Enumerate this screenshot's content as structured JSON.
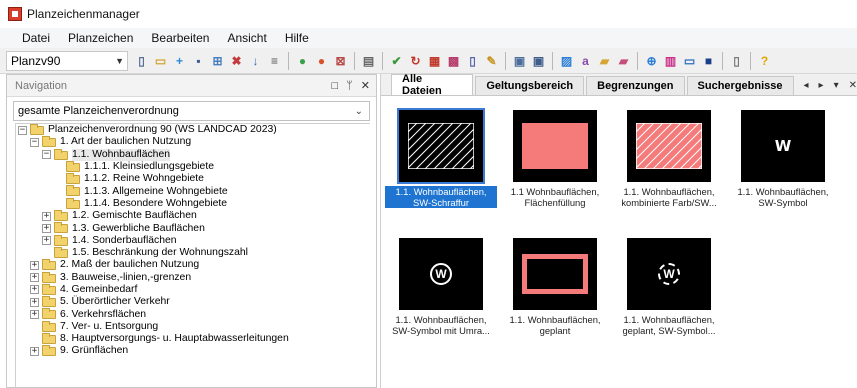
{
  "window": {
    "title": "Planzeichenmanager"
  },
  "menu": [
    "Datei",
    "Planzeichen",
    "Bearbeiten",
    "Ansicht",
    "Hilfe"
  ],
  "toolbar": {
    "combo_value": "Planzv90",
    "buttons": [
      {
        "name": "new-document-icon",
        "glyph": "▯",
        "color": "#5a6f9a"
      },
      {
        "name": "open-folder-icon",
        "glyph": "▭",
        "color": "#d4a536"
      },
      {
        "name": "add-icon",
        "glyph": "+",
        "color": "#2d8ad6"
      },
      {
        "name": "save-icon",
        "glyph": "▪",
        "color": "#3c5a9a"
      },
      {
        "name": "hierarchy-icon",
        "glyph": "⊞",
        "color": "#4a7fbf"
      },
      {
        "name": "delete-icon",
        "glyph": "✖",
        "color": "#c33b3b"
      },
      {
        "name": "sort-icon",
        "glyph": "↓",
        "color": "#3e6ab3"
      },
      {
        "name": "list-icon",
        "glyph": "≡",
        "color": "#555555"
      },
      {
        "name": "green-circle-icon",
        "glyph": "●",
        "color": "#3aa14a"
      },
      {
        "name": "red-circle-icon",
        "glyph": "●",
        "color": "#d6532b"
      },
      {
        "name": "close-box-icon",
        "glyph": "⊠",
        "color": "#b84c4c"
      },
      {
        "name": "print-icon",
        "glyph": "▤",
        "color": "#666666"
      },
      {
        "name": "check-icon",
        "glyph": "✔",
        "color": "#3a9a3a"
      },
      {
        "name": "refresh-icon",
        "glyph": "↻",
        "color": "#c0392b"
      },
      {
        "name": "table-icon",
        "glyph": "▦",
        "color": "#c0392b"
      },
      {
        "name": "layout-icon",
        "glyph": "▩",
        "color": "#b43a6a"
      },
      {
        "name": "document-icon",
        "glyph": "▯",
        "color": "#5566aa"
      },
      {
        "name": "pen-icon",
        "glyph": "✎",
        "color": "#c89320"
      },
      {
        "name": "window-icon",
        "glyph": "▣",
        "color": "#4d6d9a"
      },
      {
        "name": "window2-icon",
        "glyph": "▣",
        "color": "#3e5d8a"
      },
      {
        "name": "image-icon",
        "glyph": "▨",
        "color": "#2c7fd6"
      },
      {
        "name": "text-icon",
        "glyph": "a",
        "color": "#8a4aa8"
      },
      {
        "name": "folder-image-icon",
        "glyph": "▰",
        "color": "#d6a536"
      },
      {
        "name": "folder-pink-icon",
        "glyph": "▰",
        "color": "#c44f7a"
      },
      {
        "name": "zoom-icon",
        "glyph": "⊕",
        "color": "#2d7fd6"
      },
      {
        "name": "chart-icon",
        "glyph": "▥",
        "color": "#c8308a"
      },
      {
        "name": "panel-icon",
        "glyph": "▭",
        "color": "#2d6fbf"
      },
      {
        "name": "stop-icon",
        "glyph": "■",
        "color": "#1a3f8a"
      },
      {
        "name": "page-icon",
        "glyph": "▯",
        "color": "#7a7a7a"
      },
      {
        "name": "help-icon",
        "glyph": "?",
        "color": "#e0a800"
      }
    ]
  },
  "navigation": {
    "title": "Navigation",
    "scope_value": "gesamte Planzeichenverordnung",
    "tree": [
      {
        "label": "Planzeichenverordnung 90 (WS LANDCAD 2023)",
        "level": 0,
        "expander": "−"
      },
      {
        "label": "1. Art der baulichen Nutzung",
        "level": 1,
        "expander": "−"
      },
      {
        "label": "1.1. Wohnbauflächen",
        "level": 2,
        "expander": "−",
        "selected": true
      },
      {
        "label": "1.1.1. Kleinsiedlungsgebiete",
        "level": 3,
        "expander": ""
      },
      {
        "label": "1.1.2. Reine Wohngebiete",
        "level": 3,
        "expander": ""
      },
      {
        "label": "1.1.3. Allgemeine Wohngebiete",
        "level": 3,
        "expander": ""
      },
      {
        "label": "1.1.4. Besondere Wohngebiete",
        "level": 3,
        "expander": ""
      },
      {
        "label": "1.2. Gemischte Bauflächen",
        "level": 2,
        "expander": "+"
      },
      {
        "label": "1.3. Gewerbliche Bauflächen",
        "level": 2,
        "expander": "+"
      },
      {
        "label": "1.4. Sonderbauflächen",
        "level": 2,
        "expander": "+"
      },
      {
        "label": "1.5. Beschränkung der Wohnungszahl",
        "level": 2,
        "expander": ""
      },
      {
        "label": "2. Maß der baulichen Nutzung",
        "level": 1,
        "expander": "+"
      },
      {
        "label": "3. Bauweise,-linien,-grenzen",
        "level": 1,
        "expander": "+"
      },
      {
        "label": "4. Gemeinbedarf",
        "level": 1,
        "expander": "+"
      },
      {
        "label": "5. Überörtlicher Verkehr",
        "level": 1,
        "expander": "+"
      },
      {
        "label": "6. Verkehrsflächen",
        "level": 1,
        "expander": "+"
      },
      {
        "label": "7. Ver- u. Entsorgung",
        "level": 1,
        "expander": ""
      },
      {
        "label": "8. Hauptversorgungs- u. Hauptabwasserleitungen",
        "level": 1,
        "expander": ""
      },
      {
        "label": "9. Grünflächen",
        "level": 1,
        "expander": "+"
      }
    ]
  },
  "tabs": [
    {
      "label": "Alle Dateien",
      "active": true
    },
    {
      "label": "Geltungsbereich",
      "active": false
    },
    {
      "label": "Begrenzungen",
      "active": false
    },
    {
      "label": "Suchergebnisse",
      "active": false
    }
  ],
  "tab_controls": [
    "◂",
    "▸",
    "▾",
    "✕"
  ],
  "tiles": [
    {
      "caption": "1.1. Wohnbauflächen, SW-Schraffur",
      "preview": "hatch-white",
      "selected": true
    },
    {
      "caption": "1.1 Wohnbauflächen, Flächenfüllung",
      "preview": "fill-salmon",
      "selected": false
    },
    {
      "caption": "1.1. Wohnbauflächen, kombinierte Farb/SW...",
      "preview": "hatch-salmon",
      "selected": false
    },
    {
      "caption": "1.1. Wohnbauflächen, SW-Symbol",
      "preview": "symbol-w",
      "symbol": "W",
      "selected": false
    },
    {
      "caption": "1.1. Wohnbauflächen, SW-Symbol mit Umra...",
      "preview": "circle-w",
      "symbol": "W",
      "selected": false
    },
    {
      "caption": "1.1. Wohnbauflächen, geplant",
      "preview": "outline-salmon",
      "selected": false
    },
    {
      "caption": "1.1. Wohnbauflächen, geplant, SW-Symbol...",
      "preview": "dashed-circle-w",
      "symbol": "W",
      "selected": false
    }
  ],
  "colors": {
    "accent": "#1e74d0",
    "salmon": "#f57b7b",
    "folder": "#f2d36b"
  }
}
